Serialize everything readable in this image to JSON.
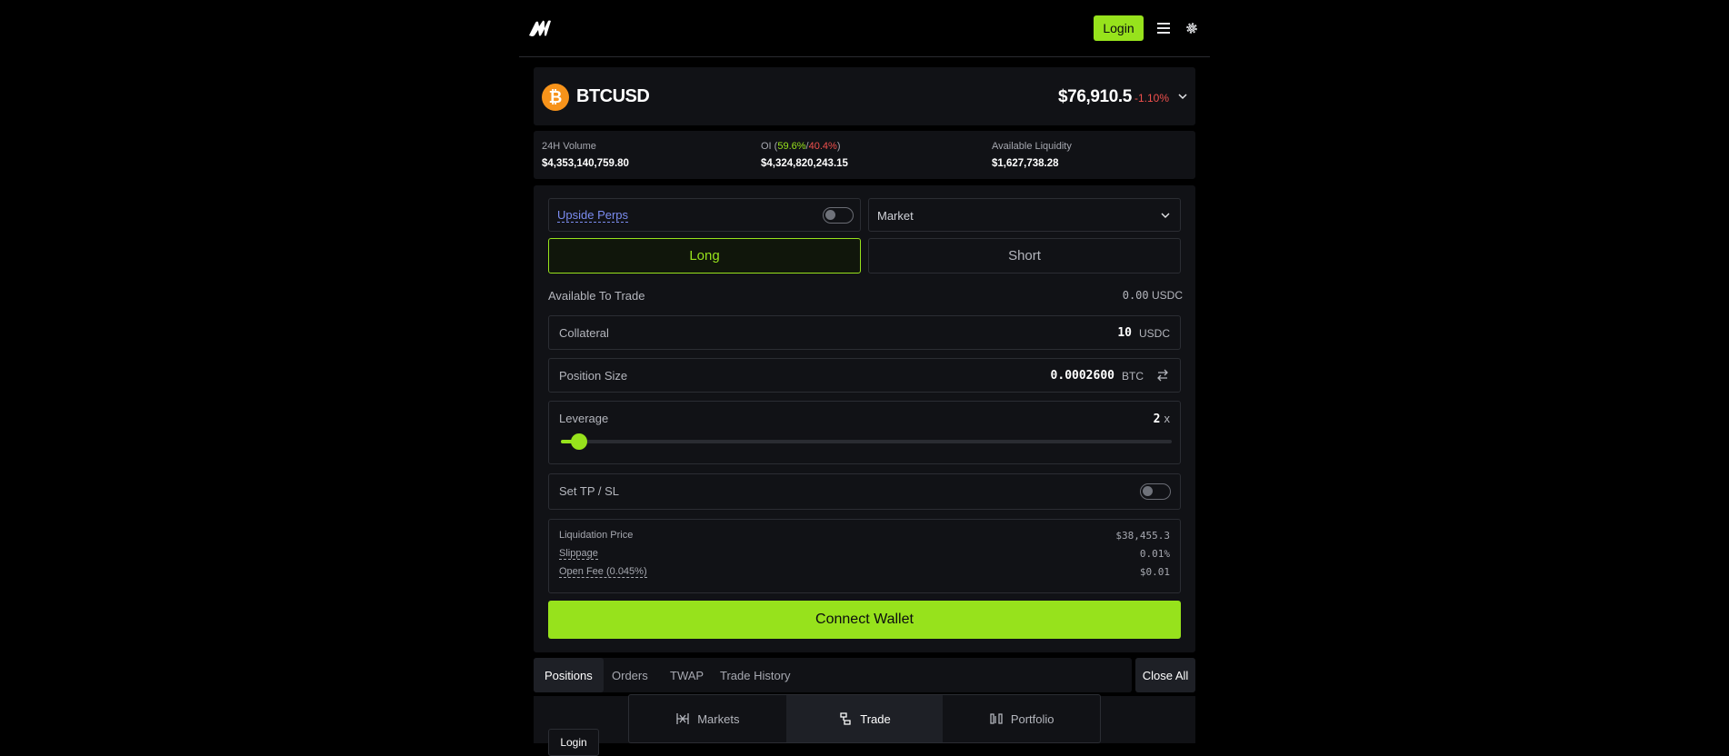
{
  "header": {
    "login_label": "Login",
    "icons": [
      "logo-icon",
      "menu-icon",
      "gear-icon"
    ]
  },
  "market": {
    "coin_icon": "bitcoin-icon",
    "symbol": "BTCUSD",
    "price": "$76,910.5",
    "change": "-1.10%"
  },
  "stats": {
    "volume_label": "24H Volume",
    "volume_value": "$4,353,140,759.80",
    "oi_prefix": "OI (",
    "oi_long": "59.6%",
    "oi_sep": "/",
    "oi_short": "40.4%",
    "oi_suffix": ")",
    "oi_value": "$4,324,820,243.15",
    "liquidity_label": "Available Liquidity",
    "liquidity_value": "$1,627,738.28"
  },
  "form": {
    "upside_label": "Upside Perps",
    "upside_enabled": false,
    "order_type": "Market",
    "long_label": "Long",
    "short_label": "Short",
    "selected_side": "Long",
    "available_label": "Available To Trade",
    "available_value": "0.00",
    "available_unit": "USDC",
    "collateral_label": "Collateral",
    "collateral_value": "10",
    "collateral_unit": "USDC",
    "position_size_label": "Position Size",
    "position_size_value": "0.0002600",
    "position_size_unit": "BTC",
    "leverage_label": "Leverage",
    "leverage_value": "2",
    "leverage_unit": "x",
    "leverage_fraction": 0.03,
    "tpsl_label": "Set TP / SL",
    "tpsl_enabled": false,
    "liq_price_label": "Liquidation Price",
    "liq_price_value": "$38,455.3",
    "slippage_label": "Slippage",
    "slippage_value": "0.01%",
    "open_fee_label": "Open Fee (0.045%)",
    "open_fee_value": "$0.01",
    "connect_label": "Connect Wallet"
  },
  "tabs": {
    "items": [
      "Positions",
      "Orders",
      "TWAP",
      "Trade History"
    ],
    "active": "Positions",
    "close_all_label": "Close All"
  },
  "bottom_login_label": "Login",
  "bottom_nav": {
    "items": [
      {
        "label": "Markets",
        "icon": "markets-icon"
      },
      {
        "label": "Trade",
        "icon": "trade-icon"
      },
      {
        "label": "Portfolio",
        "icon": "portfolio-icon"
      }
    ],
    "active": "Trade"
  },
  "colors": {
    "accent": "#97e21c",
    "negative": "#f0504d",
    "link": "#7b8cf0",
    "panel": "#111216",
    "background": "#000000"
  }
}
